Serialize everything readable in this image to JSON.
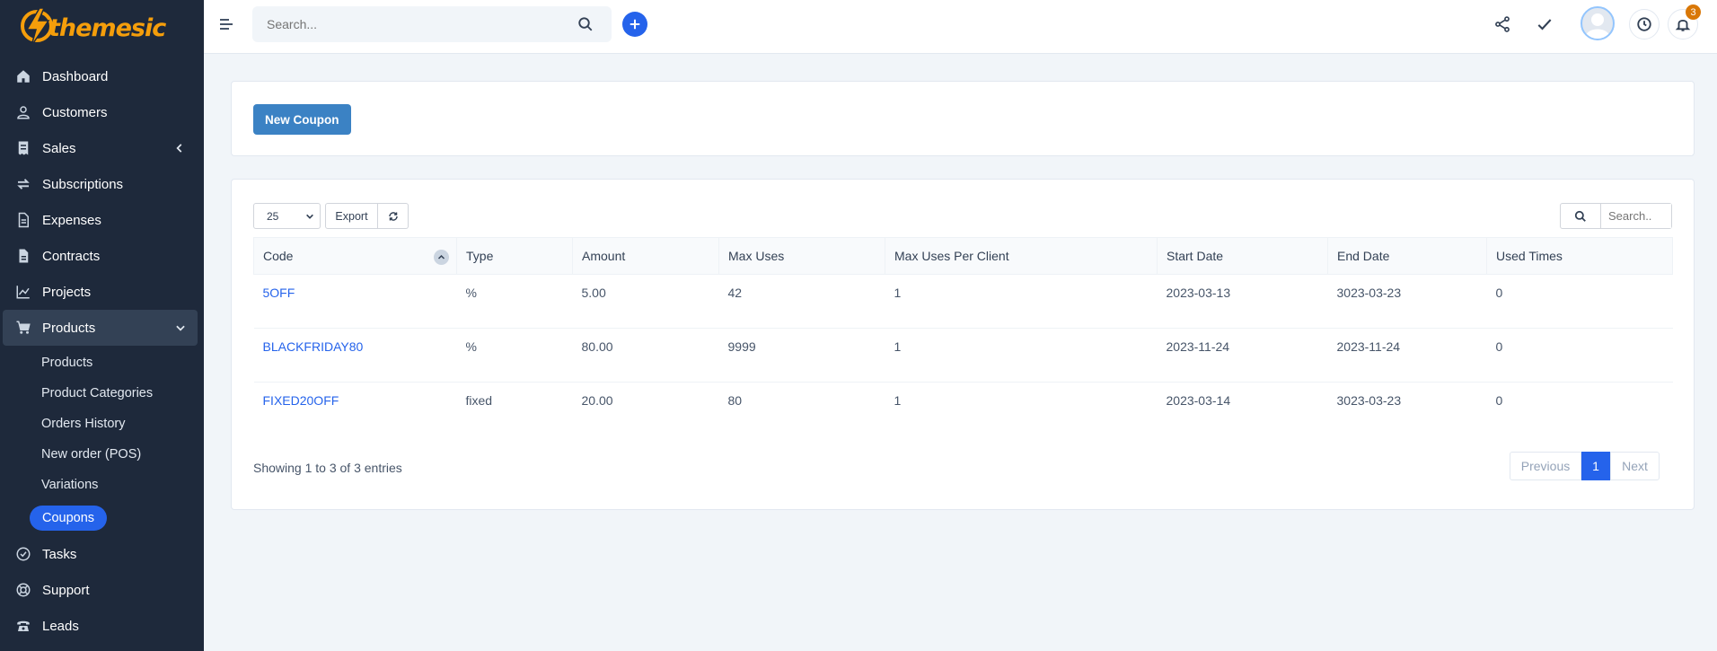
{
  "brand": {
    "name": "themesic",
    "color": "#f59e0b"
  },
  "sidebar": {
    "items": [
      {
        "label": "Dashboard",
        "icon": "home-icon"
      },
      {
        "label": "Customers",
        "icon": "user-icon"
      },
      {
        "label": "Sales",
        "icon": "receipt-icon"
      },
      {
        "label": "Subscriptions",
        "icon": "refresh-icon"
      },
      {
        "label": "Expenses",
        "icon": "file-icon"
      },
      {
        "label": "Contracts",
        "icon": "contract-icon"
      },
      {
        "label": "Projects",
        "icon": "chart-icon"
      },
      {
        "label": "Products",
        "icon": "cart-icon"
      }
    ],
    "products_sub": [
      "Products",
      "Product Categories",
      "Orders History",
      "New order (POS)",
      "Variations"
    ],
    "active_sub": "Coupons",
    "bottom_items": [
      {
        "label": "Tasks",
        "icon": "check-circle-icon"
      },
      {
        "label": "Support",
        "icon": "lifebuoy-icon"
      },
      {
        "label": "Leads",
        "icon": "phone-icon"
      }
    ]
  },
  "header": {
    "search_placeholder": "Search...",
    "notification_count": "3"
  },
  "toolbar": {
    "new_coupon": "New Coupon"
  },
  "table_controls": {
    "page_length": "25",
    "export": "Export",
    "search_placeholder": "Search.."
  },
  "table": {
    "columns": [
      "Code",
      "Type",
      "Amount",
      "Max Uses",
      "Max Uses Per Client",
      "Start Date",
      "End Date",
      "Used Times"
    ],
    "rows": [
      [
        "5OFF",
        "%",
        "5.00",
        "42",
        "1",
        "2023-03-13",
        "3023-03-23",
        "0"
      ],
      [
        "BLACKFRIDAY80",
        "%",
        "80.00",
        "9999",
        "1",
        "2023-11-24",
        "2023-11-24",
        "0"
      ],
      [
        "FIXED20OFF",
        "fixed",
        "20.00",
        "80",
        "1",
        "2023-03-14",
        "3023-03-23",
        "0"
      ]
    ]
  },
  "footer": {
    "info": "Showing 1 to 3 of 3 entries",
    "previous": "Previous",
    "page": "1",
    "next": "Next"
  }
}
